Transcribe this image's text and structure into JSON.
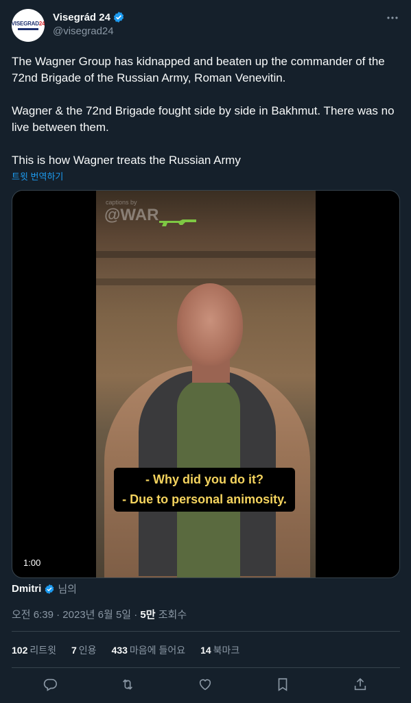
{
  "author": {
    "display_name": "Visegrád 24",
    "handle": "@visegrad24",
    "avatar_text_a": "VISEGRAD",
    "avatar_text_b": "24"
  },
  "tweet": {
    "paragraphs": [
      "The Wagner Group has kidnapped and beaten up the commander of the 72nd Brigade of the Russian Army, Roman Venevitin.",
      "Wagner & the 72nd Brigade fought side by side in Bakhmut. There was no live between them.",
      "This is how Wagner treats the Russian Army"
    ],
    "translate_link": "트윗 번역하기"
  },
  "media": {
    "watermark_small": "captions by",
    "watermark": "@WAR",
    "subtitle_1": "- Why did you do it?",
    "subtitle_2": "- Due to personal animosity.",
    "duration": "1:00"
  },
  "source": {
    "name": "Dmitri",
    "suffix": "님의"
  },
  "meta": {
    "time_date": "오전 6:39 · 2023년 6월 5일 · ",
    "views_num": "5만",
    "views_label": " 조회수"
  },
  "stats": [
    {
      "num": "102",
      "label": "리트윗"
    },
    {
      "num": "7",
      "label": "인용"
    },
    {
      "num": "433",
      "label": "마음에 들어요"
    },
    {
      "num": "14",
      "label": "북마크"
    }
  ],
  "colors": {
    "background": "#15202b",
    "accent": "#1d9bf0",
    "muted_text": "#8b98a5",
    "subtitle": "#f4d35e"
  },
  "icons": [
    "verified-badge-icon",
    "more-icon",
    "rifle-icon",
    "reply-icon",
    "retweet-icon",
    "like-icon",
    "bookmark-icon",
    "share-icon"
  ]
}
